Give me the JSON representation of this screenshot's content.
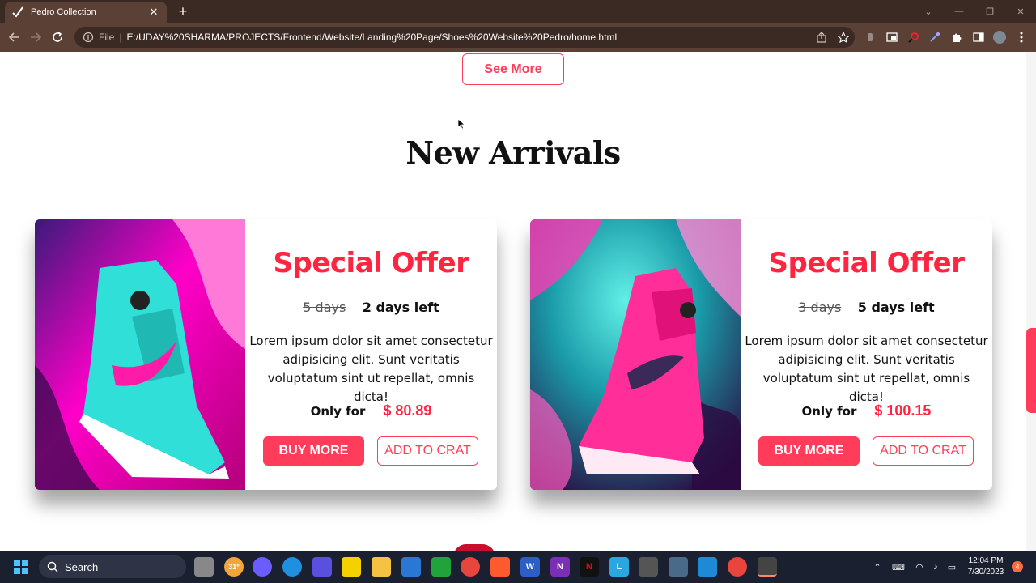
{
  "browser": {
    "tab_title": "Pedro Collection",
    "close_glyph": "✕",
    "new_tab_glyph": "+",
    "file_label": "File",
    "url": "E:/UDAY%20SHARMA/PROJECTS/Frontend/Website/Landing%20Page/Shoes%20Website%20Pedro/home.html"
  },
  "page": {
    "see_more_label": "See More",
    "section_title": "New Arrivals",
    "cards": [
      {
        "title": "Special Offer",
        "old_days": "5 days",
        "new_days": "2 days left",
        "description": "Lorem ipsum dolor sit amet consectetur adipisicing elit. Sunt veritatis voluptatum sint ut repellat, omnis dicta!",
        "price_label": "Only for",
        "price": "$ 80.89",
        "buy_label": "BUY MORE",
        "add_label": "ADD TO CRAT"
      },
      {
        "title": "Special Offer",
        "old_days": "3 days",
        "new_days": "5 days left",
        "description": "Lorem ipsum dolor sit amet consectetur adipisicing elit. Sunt veritatis voluptatum sint ut repellat, omnis dicta!",
        "price_label": "Only for",
        "price": "$ 100.15",
        "buy_label": "BUY MORE",
        "add_label": "ADD TO CRAT"
      }
    ]
  },
  "taskbar": {
    "search_label": "Search",
    "weather": "31°",
    "time": "12:04 PM",
    "date": "7/30/2023",
    "notification_count": "4"
  },
  "colors": {
    "accent": "#ff3d5a",
    "browser_frame": "#3b2a24",
    "taskbar": "#1b2030"
  }
}
